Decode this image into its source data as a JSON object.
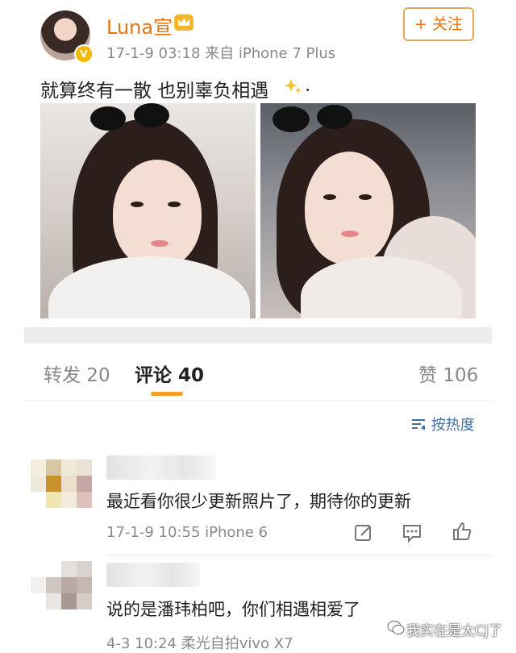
{
  "post": {
    "username": "Luna宣",
    "verified_badge": "V",
    "meta": "17-1-9 03:18 来自 iPhone 7 Plus",
    "follow_label": "+ 关注",
    "text": "就算终有一散 也别辜负相遇",
    "text_end": ".",
    "icons": [
      "avatar",
      "crown-icon",
      "sparkle-emoji"
    ]
  },
  "tabs": [
    {
      "label": "转发 20"
    },
    {
      "label": "评论 40"
    },
    {
      "label": "赞 106"
    }
  ],
  "sort_label": "按热度",
  "comments": [
    {
      "text": "最近看你很少更新照片了，期待你的更新",
      "meta": "17-1-9 10:55 iPhone 6"
    },
    {
      "text": "说的是潘玮柏吧，你们相遇相爱了",
      "meta": "4-3 10:24 柔光自拍vivo X7"
    }
  ],
  "watermark": "我实在是太CJ了",
  "colors": {
    "accent": "#e8740f",
    "tab_indicator": "#f0a020",
    "link": "#3e6ea4"
  }
}
